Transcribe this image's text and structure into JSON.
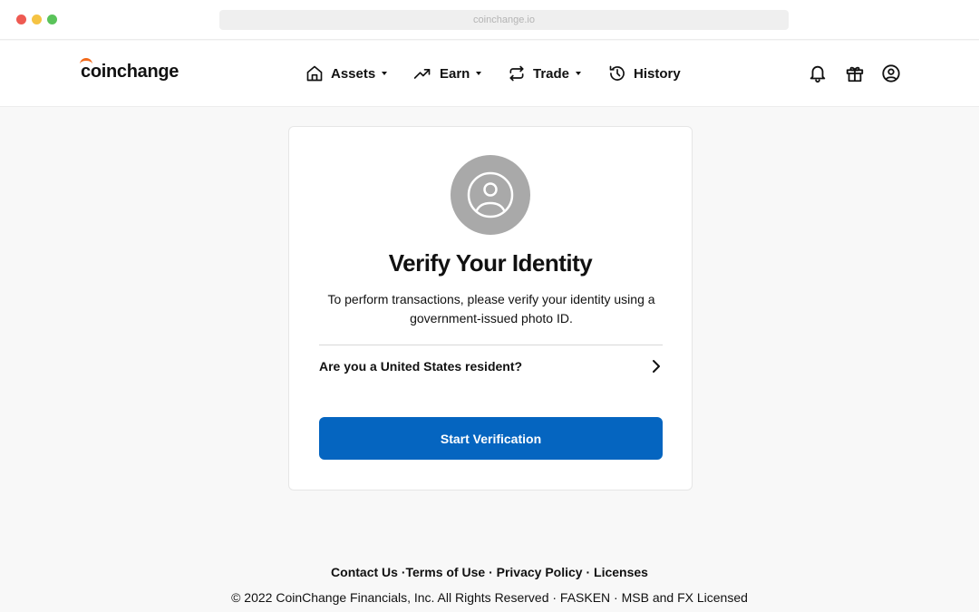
{
  "browser": {
    "url": "coinchange.io"
  },
  "header": {
    "logo": "coinchange",
    "nav": [
      {
        "label": "Assets",
        "icon": "home-icon",
        "dropdown": true
      },
      {
        "label": "Earn",
        "icon": "trending-up-icon",
        "dropdown": true
      },
      {
        "label": "Trade",
        "icon": "swap-icon",
        "dropdown": true
      },
      {
        "label": "History",
        "icon": "history-icon",
        "dropdown": false
      }
    ],
    "actions": [
      "bell-icon",
      "gift-icon",
      "user-icon"
    ]
  },
  "card": {
    "icon": "user-avatar-icon",
    "title": "Verify Your Identity",
    "description": "To perform transactions, please verify your identity using a government-issued photo ID.",
    "resident_question": "Are you a United States resident?",
    "start_button": "Start Verification"
  },
  "footer": {
    "links": [
      "Contact Us",
      "Terms of Use",
      "Privacy Policy",
      "Licenses"
    ],
    "copyright": "© 2022 CoinChange Financials, Inc. All Rights Reserved · FASKEN · MSB and FX Licensed"
  },
  "colors": {
    "brand_accent": "#f26a1b",
    "primary_button": "#0565c0",
    "avatar_bg": "#a9a9a9",
    "page_bg": "#f8f8f8"
  }
}
